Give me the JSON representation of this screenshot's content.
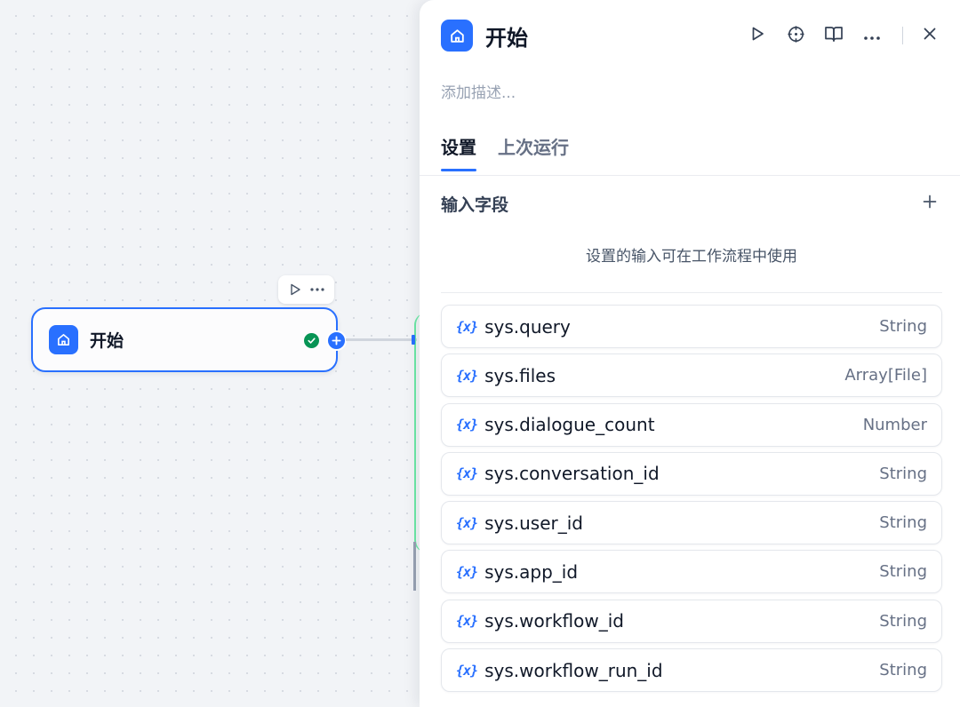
{
  "canvas": {
    "start_node": {
      "title": "开始"
    }
  },
  "panel": {
    "title": "开始",
    "description_placeholder": "添加描述...",
    "tabs": [
      {
        "label": "设置",
        "active": true
      },
      {
        "label": "上次运行",
        "active": false
      }
    ],
    "input_section": {
      "title": "输入字段",
      "hint": "设置的输入可在工作流程中使用",
      "variable_icon": "{x}",
      "variables": [
        {
          "name": "sys.query",
          "type": "String"
        },
        {
          "name": "sys.files",
          "type": "Array[File]"
        },
        {
          "name": "sys.dialogue_count",
          "type": "Number"
        },
        {
          "name": "sys.conversation_id",
          "type": "String"
        },
        {
          "name": "sys.user_id",
          "type": "String"
        },
        {
          "name": "sys.app_id",
          "type": "String"
        },
        {
          "name": "sys.workflow_id",
          "type": "String"
        },
        {
          "name": "sys.workflow_run_id",
          "type": "String"
        }
      ]
    }
  },
  "icons": {
    "node": "home-icon",
    "actions": [
      "play-icon",
      "locate-icon",
      "book-icon",
      "more-icon",
      "close-icon"
    ],
    "add": "plus-icon",
    "status": "check-circle-icon"
  },
  "colors": {
    "accent": "#2970ff",
    "success": "#079455",
    "edge_next": "#6ce9a6"
  }
}
